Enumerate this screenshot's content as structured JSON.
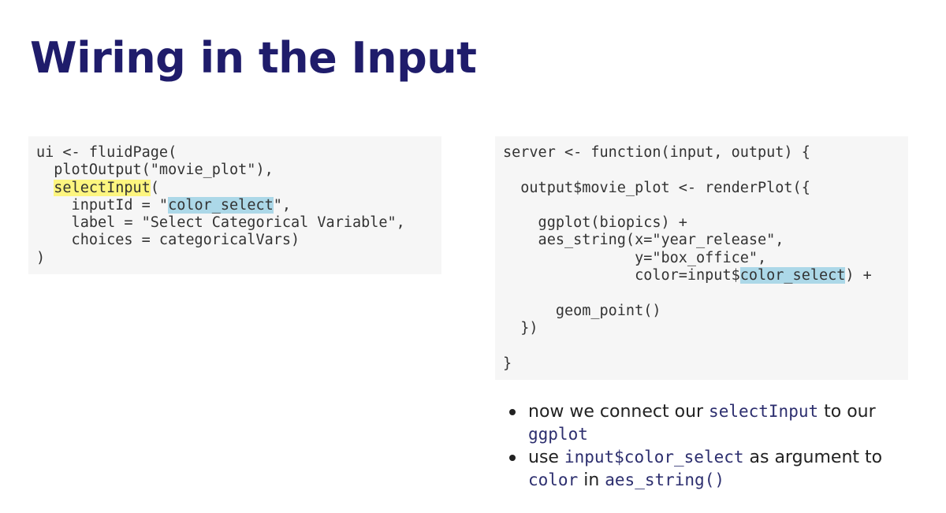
{
  "title": "Wiring in the Input",
  "ui_code": {
    "line1": "ui <- fluidPage(",
    "line2": "  plotOutput(\"movie_plot\"),",
    "line3_pre": "  ",
    "line3_hl": "selectInput",
    "line3_post": "(",
    "line4_pre": "    inputId = \"",
    "line4_hl": "color_select",
    "line4_post": "\",",
    "line5": "    label = \"Select Categorical Variable\",",
    "line6": "    choices = categoricalVars)",
    "line7": ")"
  },
  "server_code": {
    "line1": "server <- function(input, output) {",
    "line2": "",
    "line3": "  output$movie_plot <- renderPlot({",
    "line4": "",
    "line5": "    ggplot(biopics) +",
    "line6": "    aes_string(x=\"year_release\",",
    "line7": "               y=\"box_office\",",
    "line8_pre": "               color=input$",
    "line8_hl": "color_select",
    "line8_post": ") +",
    "line9": "",
    "line10": "      geom_point()",
    "line11": "  })",
    "line12": "",
    "line13": "}"
  },
  "bullets": [
    {
      "t1": "now we connect our ",
      "c1": "selectInput",
      "t2": " to our ",
      "c2": "ggplot"
    },
    {
      "t1": "use ",
      "c1": "input$color_select",
      "t2": " as argument to ",
      "c2": "color",
      "t3": " in ",
      "c3": "aes_string()"
    }
  ],
  "colors": {
    "title": "#1f1c6b",
    "code_background": "#f6f6f6",
    "highlight_yellow": "#fdf57f",
    "highlight_blue": "#acd8e8",
    "inline_code": "#2c2e6e"
  }
}
